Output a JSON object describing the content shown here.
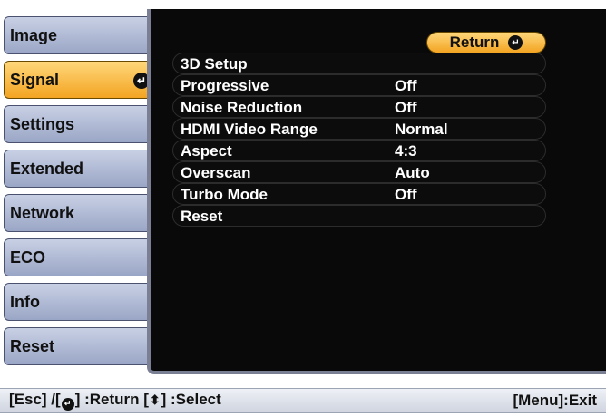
{
  "nav": {
    "items": [
      {
        "label": "Image",
        "selected": false
      },
      {
        "label": "Signal",
        "selected": true
      },
      {
        "label": "Settings",
        "selected": false
      },
      {
        "label": "Extended",
        "selected": false
      },
      {
        "label": "Network",
        "selected": false
      },
      {
        "label": "ECO",
        "selected": false
      },
      {
        "label": "Info",
        "selected": false
      },
      {
        "label": "Reset",
        "selected": false
      }
    ],
    "enter_icon": "enter-icon"
  },
  "panel": {
    "return_label": "Return",
    "return_icon": "enter-icon",
    "rows": [
      {
        "label": "3D Setup",
        "value": ""
      },
      {
        "label": "Progressive",
        "value": "Off"
      },
      {
        "label": "Noise Reduction",
        "value": "Off"
      },
      {
        "label": "HDMI Video Range",
        "value": "Normal"
      },
      {
        "label": "Aspect",
        "value": "4:3"
      },
      {
        "label": "Overscan",
        "value": "Auto"
      },
      {
        "label": "Turbo Mode",
        "value": "Off"
      },
      {
        "label": "Reset",
        "value": ""
      }
    ]
  },
  "footer": {
    "left_part1": "[Esc] /[",
    "left_part2": "] :Return  [",
    "left_part3": "] :Select",
    "right": "[Menu]:Exit",
    "icons": [
      "enter-icon",
      "up-down-arrow-icon"
    ]
  },
  "colors": {
    "selected_tab": "#f3a422",
    "tab": "#9aa6c6",
    "panel": "#090909"
  }
}
